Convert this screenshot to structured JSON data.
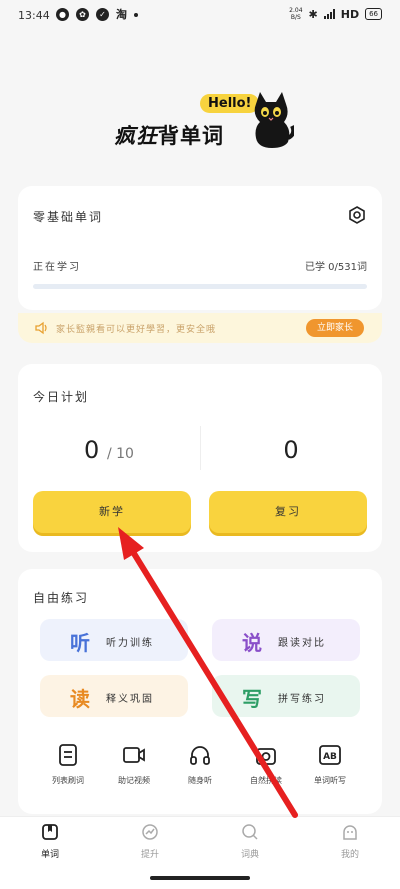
{
  "status_bar": {
    "time": "13:44",
    "app_letter": "淘",
    "net_speed_value": "2.04",
    "net_speed_unit": "B/S",
    "network": "HD",
    "battery": "66"
  },
  "logo": {
    "hello": "Hello!",
    "text_italic": "疯狂",
    "text_normal": "背单词"
  },
  "book_card": {
    "title": "零基础单词",
    "status": "正在学习",
    "learned": "已学 0/531词",
    "progress": 0
  },
  "notice": {
    "text": "家长監親看可以更好學習，更安全哦",
    "button": "立即家长"
  },
  "plan_card": {
    "title": "今日计划",
    "new_count": "0",
    "new_total": "/ 10",
    "review_count": "0",
    "new_button": "新学",
    "review_button": "复习"
  },
  "practice_card": {
    "title": "自由练习",
    "modes": [
      {
        "char": "听",
        "label": "听力训练"
      },
      {
        "char": "说",
        "label": "跟读对比"
      },
      {
        "char": "读",
        "label": "释义巩固"
      },
      {
        "char": "写",
        "label": "拼写练习"
      }
    ],
    "tools": [
      {
        "icon": "list-icon",
        "label": "列表刷词"
      },
      {
        "icon": "video-icon",
        "label": "助记视频"
      },
      {
        "icon": "headphones-icon",
        "label": "随身听"
      },
      {
        "icon": "camera-icon",
        "label": "自然拼读"
      },
      {
        "icon": "ab-icon",
        "label": "单词听写"
      }
    ]
  },
  "tabbar": {
    "tabs": [
      {
        "label": "单词",
        "icon": "book-icon",
        "active": true
      },
      {
        "label": "提升",
        "icon": "chart-icon",
        "active": false
      },
      {
        "label": "词典",
        "icon": "search-icon",
        "active": false
      },
      {
        "label": "我的",
        "icon": "profile-icon",
        "active": false
      }
    ]
  },
  "colors": {
    "accent_yellow": "#f9d33e",
    "notice_bg": "#fdf6dc",
    "notice_button": "#f0962e",
    "annotation_arrow": "#e62020"
  }
}
